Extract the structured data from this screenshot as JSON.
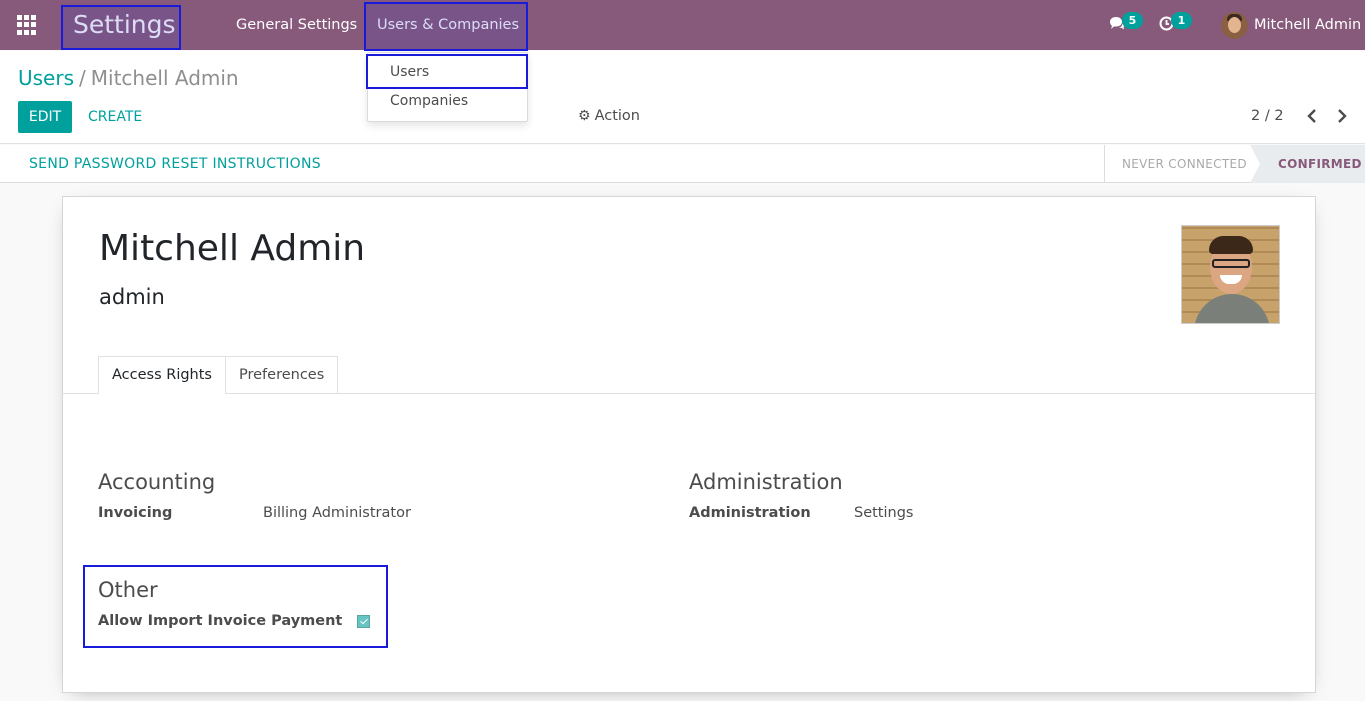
{
  "navbar": {
    "app_title": "Settings",
    "menus": [
      "General Settings",
      "Users & Companies"
    ],
    "messages_count": "5",
    "activities_count": "1",
    "user_name": "Mitchell Admin",
    "bg_color": "#875a7b"
  },
  "dropdown": {
    "items": [
      "Users",
      "Companies"
    ]
  },
  "breadcrumb": {
    "parent": "Users",
    "separator": "/",
    "current": "Mitchell Admin"
  },
  "toolbar": {
    "edit_label": "EDIT",
    "create_label": "CREATE",
    "action_label": "Action",
    "pager": "2 / 2"
  },
  "statusbar": {
    "reset_label": "SEND PASSWORD RESET INSTRUCTIONS",
    "stages": [
      "NEVER CONNECTED",
      "CONFIRMED"
    ],
    "active_stage": "CONFIRMED"
  },
  "form": {
    "name": "Mitchell Admin",
    "login": "admin",
    "tabs": [
      "Access Rights",
      "Preferences"
    ],
    "active_tab": "Access Rights",
    "groups": {
      "accounting": {
        "title": "Accounting",
        "field_label": "Invoicing",
        "field_value": "Billing Administrator"
      },
      "administration": {
        "title": "Administration",
        "field_label": "Administration",
        "field_value": "Settings"
      },
      "other": {
        "title": "Other",
        "field_label": "Allow Import Invoice Payment",
        "checked": true
      }
    }
  },
  "colors": {
    "accent": "#00a09d",
    "brand": "#875a7b",
    "highlight": "#1a1adb"
  },
  "icons": [
    "apps-grid-icon",
    "chat-icon",
    "clock-icon",
    "gear-icon",
    "chevron-left-icon",
    "chevron-right-icon",
    "checkmark-icon"
  ]
}
